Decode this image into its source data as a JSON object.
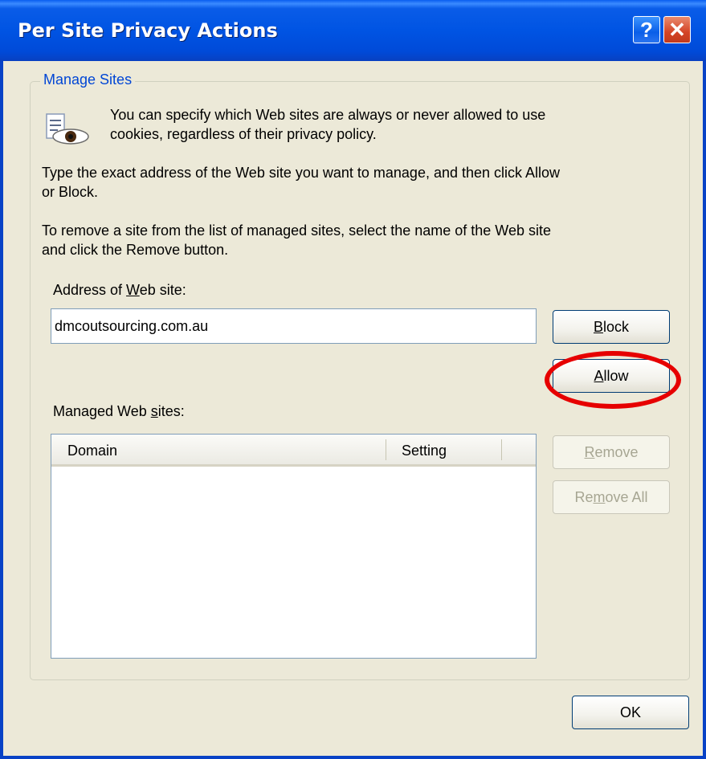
{
  "window": {
    "title": "Per Site Privacy Actions"
  },
  "titlebar": {
    "help_glyph": "?",
    "close_glyph": "✕"
  },
  "group": {
    "label": "Manage Sites"
  },
  "intro_line1": "You can specify which Web sites are always or never allowed to use",
  "intro_line2": "cookies, regardless of their privacy policy.",
  "instructions_line1": "Type the exact address of the Web site you want to manage, and then click Allow",
  "instructions_line2": "or Block.",
  "remove_line1": "To remove a site from the list of managed sites, select the name of the Web site",
  "remove_line2": "and click the Remove button.",
  "address": {
    "label_pre": "Address of ",
    "label_hotkey": "W",
    "label_post": "eb site:",
    "value": "dmcoutsourcing.com.au"
  },
  "buttons": {
    "block": {
      "hotkey": "B",
      "rest": "lock"
    },
    "allow": {
      "hotkey": "A",
      "rest": "llow"
    },
    "remove": {
      "hotkey": "R",
      "rest": "emove"
    },
    "remove_all": {
      "pre": "Re",
      "hotkey": "m",
      "post": "ove All"
    },
    "ok": "OK"
  },
  "managed": {
    "label_pre": "Managed Web ",
    "label_hotkey": "s",
    "label_post": "ites:",
    "columns": [
      "Domain",
      "Setting"
    ]
  },
  "icons": {
    "title_help": "help-icon",
    "title_close": "close-icon",
    "privacy": "privacy-eye-icon"
  },
  "colors": {
    "titlebar": "#0054e3",
    "group_label": "#0046d5",
    "highlight": "#e60000",
    "dialog_bg": "#ece9d8"
  }
}
